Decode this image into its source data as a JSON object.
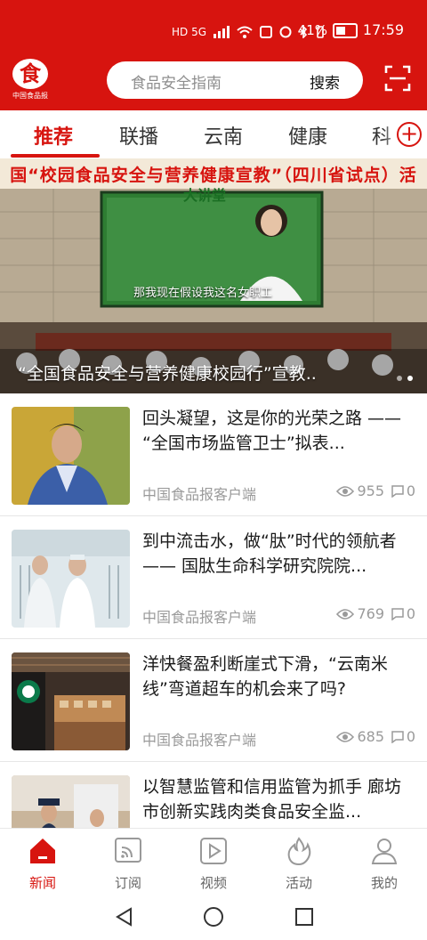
{
  "status_bar": {
    "network": "HD 5G",
    "battery_percent": "41%",
    "time": "17:59"
  },
  "header": {
    "logo_text": "中国食品报",
    "search_placeholder": "食品安全指南",
    "search_button": "搜索",
    "scan_icon": "scan-icon"
  },
  "tabs": {
    "items": [
      {
        "label": "推荐",
        "active": true
      },
      {
        "label": "联播",
        "active": false
      },
      {
        "label": "云南",
        "active": false
      },
      {
        "label": "健康",
        "active": false
      },
      {
        "label": "科",
        "active": false
      }
    ],
    "add_icon": "add-circle-icon"
  },
  "hero": {
    "banner_text": "国“校园食品安全与营养健康宣教”（四川省试点）活",
    "screen_heading": "大讲堂",
    "screen_subtitle": "那我现在假设我这名女职工",
    "caption": "“全国食品安全与营养健康校园行”宣教..",
    "dot_count": 2,
    "active_dot": 1
  },
  "news": [
    {
      "title": "回头凝望，这是你的光荣之路 —— “全国市场监管卫士”拟表...",
      "source": "中国食品报客户端",
      "views": "955",
      "comments": "0",
      "thumb": "portrait-man"
    },
    {
      "title": "到中流击水，做“肽”时代的领航者—— 国肽生命科学研究院院...",
      "source": "中国食品报客户端",
      "views": "769",
      "comments": "0",
      "thumb": "laboratory"
    },
    {
      "title": "洋快餐盈利断崖式下滑，“云南米线”弯道超车的机会来了吗?",
      "source": "中国食品报客户端",
      "views": "685",
      "comments": "0",
      "thumb": "starbucks-store"
    },
    {
      "title": "以智慧监管和信用监管为抓手 廊坊市创新实践肉类食品安全监...",
      "source": "",
      "views": "",
      "comments": "",
      "thumb": "inspection"
    }
  ],
  "bottom_nav": [
    {
      "label": "新闻",
      "icon": "home-icon",
      "active": true
    },
    {
      "label": "订阅",
      "icon": "rss-icon",
      "active": false
    },
    {
      "label": "视频",
      "icon": "video-play-icon",
      "active": false
    },
    {
      "label": "活动",
      "icon": "flame-icon",
      "active": false
    },
    {
      "label": "我的",
      "icon": "person-icon",
      "active": false
    }
  ],
  "colors": {
    "brand": "#d7140f",
    "muted_text": "#9a9a9a"
  }
}
